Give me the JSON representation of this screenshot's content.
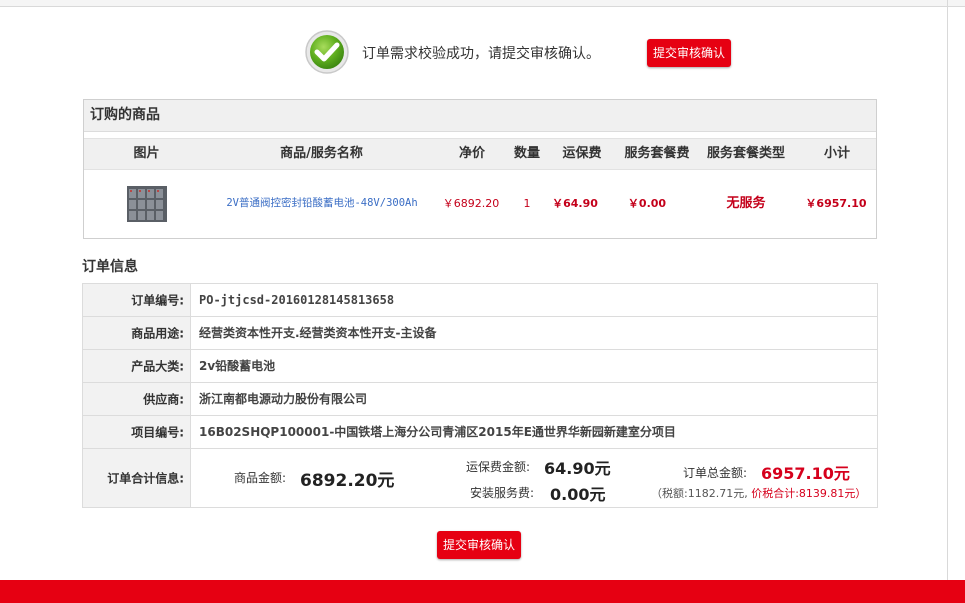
{
  "success": {
    "message": "订单需求校验成功，请提交审核确认。",
    "submit_label": "提交审核确认"
  },
  "products": {
    "title": "订购的商品",
    "headers": [
      "图片",
      "商品/服务名称",
      "净价",
      "数量",
      "运保费",
      "服务套餐费",
      "服务套餐类型",
      "小计"
    ],
    "rows": [
      {
        "image_icon": "battery-pack-image",
        "name": "2V普通阀控密封铅酸蓄电池-48V/300Ah",
        "price": "￥6892.20",
        "quantity": "1",
        "shipping": "￥64.90",
        "service_fee": "￥0.00",
        "service_type": "无服务",
        "subtotal": "￥6957.10"
      }
    ]
  },
  "order_info": {
    "title": "订单信息",
    "order_no_label": "订单编号:",
    "order_no": "PO-jtjcsd-20160128145813658",
    "usage_label": "商品用途:",
    "usage": "经营类资本性开支.经营类资本性开支-主设备",
    "category_label": "产品大类:",
    "category": "2v铅酸蓄电池",
    "supplier_label": "供应商:",
    "supplier": "浙江南都电源动力股份有限公司",
    "project_label": "项目编号:",
    "project": "16B02SHQP100001-中国铁塔上海分公司青浦区2015年E通世界华新园新建室分项目",
    "total_label": "订单合计信息:",
    "goods_amount_label": "商品金额:",
    "goods_amount": "6892.20元",
    "shipping_label": "运保费金额:",
    "shipping_amount": "64.90元",
    "install_label": "安装服务费:",
    "install_amount": "0.00元",
    "order_total_label": "订单总金额:",
    "order_total": "6957.10元",
    "tax_text": "（税额:1182.71元,",
    "tax_total_text": "价税合计:8139.81元）"
  },
  "footer": {
    "submit_label": "提交审核确认"
  },
  "colors": {
    "accent_red": "#e60012",
    "price_red": "#c4001a",
    "link_blue": "#3b6ec5"
  }
}
